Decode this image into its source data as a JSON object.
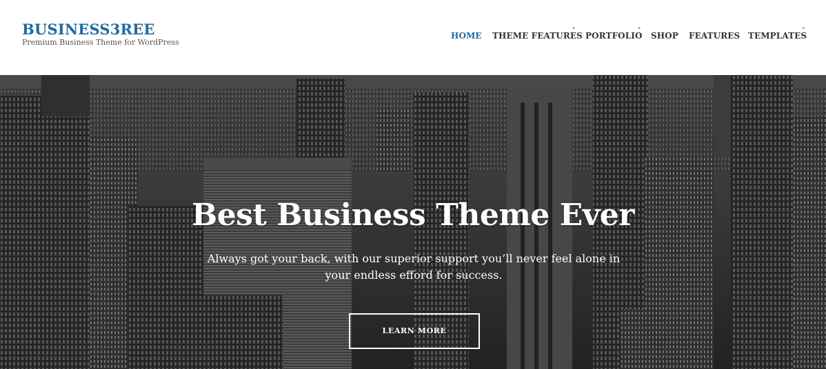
{
  "site": {
    "title": "BUSINESS3REE",
    "tagline": "Premium Business Theme for WordPress"
  },
  "nav": {
    "items": [
      {
        "label": "HOME",
        "active": true,
        "has_dropdown": false
      },
      {
        "label": "THEME FEATURES",
        "active": false,
        "has_dropdown": true
      },
      {
        "label": "PORTFOLIO",
        "active": false,
        "has_dropdown": true
      },
      {
        "label": "SHOP",
        "active": false,
        "has_dropdown": false
      },
      {
        "label": "FEATURES",
        "active": false,
        "has_dropdown": false
      },
      {
        "label": "TEMPLATES",
        "active": false,
        "has_dropdown": true
      }
    ],
    "dropdown_icon": "chevron-down-icon",
    "dropdown_glyph": "˅"
  },
  "hero": {
    "heading": "Best Business Theme Ever",
    "subtext": "Always got your back, with our superior support you’ll never feel alone in your endless efford for success.",
    "button_label": "LEARN MORE",
    "background": "grayscale city skyline photo"
  },
  "colors": {
    "brand": "#1f6a9e",
    "nav_text": "#333333",
    "hero_text": "#ffffff"
  }
}
